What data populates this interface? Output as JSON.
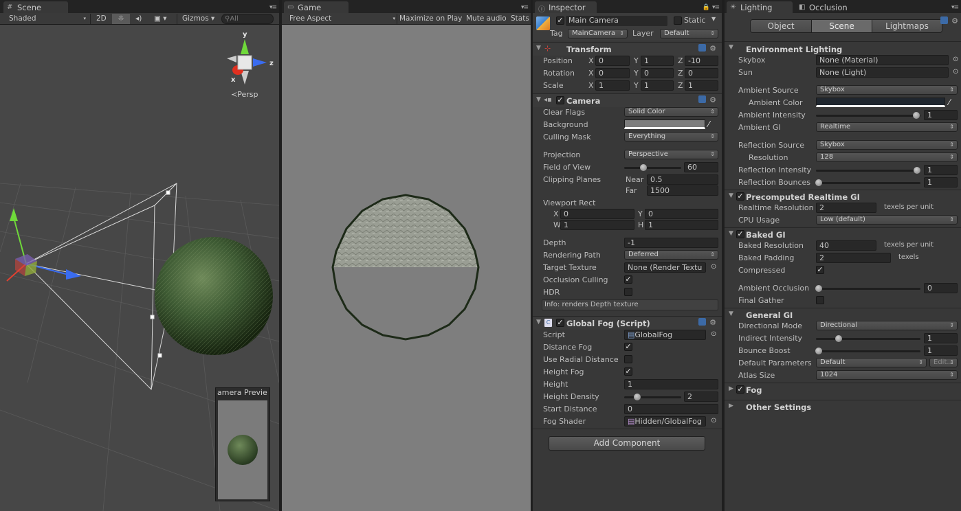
{
  "scene": {
    "tab": "Scene",
    "shading": "Shaded",
    "mode_2d": "2D",
    "gizmos": "Gizmos",
    "search_placeholder": "All",
    "persp": "Persp",
    "axis_x": "x",
    "axis_y": "y",
    "axis_z": "z",
    "camera_preview_title": "amera Previe"
  },
  "game": {
    "tab": "Game",
    "aspect": "Free Aspect",
    "maximize": "Maximize on Play",
    "mute": "Mute audio",
    "stats": "Stats"
  },
  "inspector": {
    "tab": "Inspector",
    "object_name": "Main Camera",
    "static_label": "Static",
    "tag_label": "Tag",
    "tag_value": "MainCamera",
    "layer_label": "Layer",
    "layer_value": "Default",
    "transform": {
      "title": "Transform",
      "position_label": "Position",
      "rotation_label": "Rotation",
      "scale_label": "Scale",
      "x": "X",
      "y": "Y",
      "z": "Z",
      "position": [
        "0",
        "1",
        "-10"
      ],
      "rotation": [
        "0",
        "0",
        "0"
      ],
      "scale": [
        "1",
        "1",
        "1"
      ]
    },
    "camera": {
      "title": "Camera",
      "clear_flags_label": "Clear Flags",
      "clear_flags_value": "Solid Color",
      "background_label": "Background",
      "culling_mask_label": "Culling Mask",
      "culling_mask_value": "Everything",
      "projection_label": "Projection",
      "projection_value": "Perspective",
      "fov_label": "Field of View",
      "fov_value": "60",
      "fov_fraction": 0.33,
      "clipping_label": "Clipping Planes",
      "near_label": "Near",
      "near_value": "0.5",
      "far_label": "Far",
      "far_value": "1500",
      "viewport_label": "Viewport Rect",
      "vx_label": "X",
      "vx": "0",
      "vy_label": "Y",
      "vy": "0",
      "vw_label": "W",
      "vw": "1",
      "vh_label": "H",
      "vh": "1",
      "depth_label": "Depth",
      "depth_value": "-1",
      "rendering_path_label": "Rendering Path",
      "rendering_path_value": "Deferred",
      "target_texture_label": "Target Texture",
      "target_texture_value": "None (Render Textu",
      "occlusion_label": "Occlusion Culling",
      "hdr_label": "HDR",
      "info": "Info: renders Depth texture"
    },
    "fog": {
      "title": "Global Fog (Script)",
      "script_label": "Script",
      "script_value": "GlobalFog",
      "distance_fog_label": "Distance Fog",
      "radial_label": "Use Radial Distance",
      "height_fog_label": "Height Fog",
      "height_label": "Height",
      "height_value": "1",
      "density_label": "Height Density",
      "density_value": "2",
      "density_fraction": 0.2,
      "start_label": "Start Distance",
      "start_value": "0",
      "shader_label": "Fog Shader",
      "shader_value": "Hidden/GlobalFog"
    },
    "add_component": "Add Component"
  },
  "lighting": {
    "tab": "Lighting",
    "tab2": "Occlusion",
    "btn_object": "Object",
    "btn_scene": "Scene",
    "btn_lightmaps": "Lightmaps",
    "env_title": "Environment Lighting",
    "skybox_label": "Skybox",
    "skybox_value": "None (Material)",
    "sun_label": "Sun",
    "sun_value": "None (Light)",
    "ambient_source_label": "Ambient Source",
    "ambient_source_value": "Skybox",
    "ambient_color_label": "Ambient Color",
    "ambient_intensity_label": "Ambient Intensity",
    "ambient_intensity_value": "1",
    "ambient_intensity_fraction": 1.0,
    "ambient_gi_label": "Ambient GI",
    "ambient_gi_value": "Realtime",
    "reflection_source_label": "Reflection Source",
    "reflection_source_value": "Skybox",
    "resolution_label": "Resolution",
    "resolution_value": "128",
    "reflection_intensity_label": "Reflection Intensity",
    "reflection_intensity_value": "1",
    "reflection_bounces_label": "Reflection Bounces",
    "reflection_bounces_value": "1",
    "precomputed_title": "Precomputed Realtime GI",
    "realtime_res_label": "Realtime Resolution",
    "realtime_res_value": "2",
    "texels_per_unit": "texels per unit",
    "cpu_usage_label": "CPU Usage",
    "cpu_usage_value": "Low (default)",
    "baked_title": "Baked GI",
    "baked_res_label": "Baked Resolution",
    "baked_res_value": "40",
    "baked_padding_label": "Baked Padding",
    "baked_padding_value": "2",
    "texels": "texels",
    "compressed_label": "Compressed",
    "ao_label": "Ambient Occlusion",
    "ao_value": "0",
    "final_gather_label": "Final Gather",
    "general_title": "General GI",
    "directional_mode_label": "Directional Mode",
    "directional_mode_value": "Directional",
    "indirect_label": "Indirect Intensity",
    "indirect_value": "1",
    "bounce_label": "Bounce Boost",
    "bounce_value": "1",
    "default_params_label": "Default Parameters",
    "default_params_value": "Default",
    "edit_label": "Edit...",
    "atlas_label": "Atlas Size",
    "atlas_value": "1024",
    "fog_title": "Fog",
    "other_title": "Other Settings"
  }
}
